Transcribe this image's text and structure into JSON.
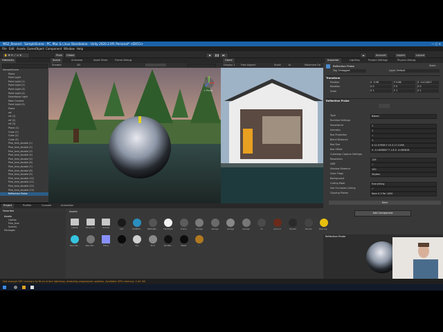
{
  "window_title": "WS2_Resend - SampleScene - PC, Mac & Linux Standalone - Unity 2020.2.0f1 Personal* <DX11>",
  "menu": [
    "File",
    "Edit",
    "Assets",
    "GameObject",
    "Component",
    "Window",
    "Help"
  ],
  "toolbar": {
    "pivot": "Pivot",
    "global": "Global",
    "account": "Account",
    "layers": "Layers",
    "layout": "Layout"
  },
  "hierarchy": {
    "tab": "Hierarchy",
    "items": [
      "SampleScene",
      "Plane",
      "Point Light",
      "Point Light (1)",
      "Point Light (2)",
      "Point Light (3)",
      "Point Light (4)",
      "Directional Light",
      "Main Camera",
      "Point Light (5)",
      "Plane",
      "ref",
      "ref (1)",
      "ref (2)",
      "ref (3)",
      "Plane (1)",
      "Cube (1)",
      "Cube (2)",
      "Cube (3)",
      "Pine_tree_double (1)",
      "Pine_tree_double (2)",
      "Pine_tree_double (3)",
      "Pine_tree_double (4)",
      "Pine_tree_double (5)",
      "Pine_tree_double (6)",
      "Pine_tree_double (7)",
      "Pine_tree_double (8)",
      "Pine_tree_double (9)",
      "Pine_tree_double (10)",
      "Pine_tree_double (11)",
      "Pine_tree_double (12)",
      "Pine_tree_double (13)",
      "Reflection Probe"
    ],
    "selected_index": 32
  },
  "scene": {
    "tabs": [
      "Scene",
      "Animator",
      "Asset Store",
      "Frame Debug"
    ],
    "shading": "Shaded",
    "mode": "2D",
    "gizmo_label": "< Persp"
  },
  "game": {
    "tab": "Game",
    "display": "Display 1",
    "aspect": "Free Aspect",
    "scale": "Scale",
    "scale_value": "1x",
    "maximize": "Maximize On Play"
  },
  "project": {
    "tabs": [
      "Project",
      "Profiler",
      "Console",
      "Animation"
    ],
    "favorites": "Favorites",
    "tree": [
      "Assets",
      "Laptop",
      "Pine_tree",
      "Scenes",
      "Packages"
    ],
    "breadcrumb": "Assets",
    "assets_row1": [
      "Laptop",
      "Pine_tree",
      "Scenes",
      "123",
      "12DEDO...",
      "1BIDUJBL...",
      "Flashlight",
      "Frame",
      "Garage",
      "Garage",
      "Garage",
      "Garage",
      "Gl",
      "Ground",
      "Handle",
      "Handel",
      "New Lig..."
    ],
    "assets_row2": [
      "New Ma...",
      "New Ma...",
      "Plane",
      "r",
      "Sky",
      "Skid",
      "TechMa...",
      "Water",
      "r"
    ],
    "asset_colors_row1": [
      "#c8c8c8",
      "#c8c8c8",
      "#c8c8c8",
      "#1a1a1a",
      "#2a8fbf",
      "#555",
      "#f2f2f2",
      "#5c5c5c",
      "#7a7a7a",
      "#6a6a6a",
      "#888",
      "#777",
      "#4a4a4a",
      "#6b2a1a",
      "#2a2a2a",
      "#444",
      "#e8c010"
    ],
    "asset_colors_row2": [
      "#36c4e0",
      "#777",
      "#8890ff",
      "#0a0a0a",
      "#d0d0d0",
      "#8a8a8a",
      "#111",
      "#0c0c0c",
      "#b07820"
    ]
  },
  "inspector": {
    "tabs": [
      "Inspector",
      "Lighting",
      "Project Settings",
      "Physics Debug"
    ],
    "object_name": "Reflection Probe",
    "static": "Static",
    "tag_label": "Tag",
    "tag": "Untagged",
    "layer_label": "Layer",
    "layer": "Default",
    "transform_title": "Transform",
    "position": [
      "X -0.58",
      "Y 0.86",
      "Z -14.21817"
    ],
    "rotation": [
      "X 0",
      "Y 0",
      "Z 0"
    ],
    "scale": [
      "X 1",
      "Y 1",
      "Z 1"
    ],
    "rows_transform": [
      "Position",
      "Rotation",
      "Scale"
    ],
    "probe_title": "Reflection Probe",
    "probe_rows": [
      {
        "k": "Type",
        "v": "Baked"
      },
      {
        "k": "Runtime Settings",
        "v": ""
      },
      {
        "k": "Importance",
        "v": "1"
      },
      {
        "k": "Intensity",
        "v": "1"
      },
      {
        "k": "Box Projection",
        "v": "✓"
      },
      {
        "k": "Blend Distance",
        "v": "1"
      },
      {
        "k": "Box Size",
        "v": "X 12.57958   Y 15   Z 17.2198"
      },
      {
        "k": "Box Offset",
        "v": "X -0.1458807   Y 1.8   Z -4.482818"
      },
      {
        "k": "Cubemap Capture Settings",
        "v": ""
      },
      {
        "k": "Resolution",
        "v": "128"
      },
      {
        "k": "HDR",
        "v": "✓"
      },
      {
        "k": "Shadow Distance",
        "v": "100"
      },
      {
        "k": "Clear Flags",
        "v": "Skybox"
      },
      {
        "k": "Background",
        "v": ""
      },
      {
        "k": "Culling Mask",
        "v": "Everything"
      },
      {
        "k": "Use Occlusion Culling",
        "v": "✓"
      },
      {
        "k": "Clipping Planes",
        "v": "Near 0.3   Far 1000"
      }
    ],
    "bake_button": "Bake",
    "add_component": "Add Component",
    "preview_title": "Reflection Probe"
  },
  "status": "Not enough GPU memory to fit an entire lightmap, disabling progressive updates. Available GPU memory: 2.44 GB",
  "colors": {
    "selection": "#2c5d87",
    "accent": "#1b62a8"
  }
}
